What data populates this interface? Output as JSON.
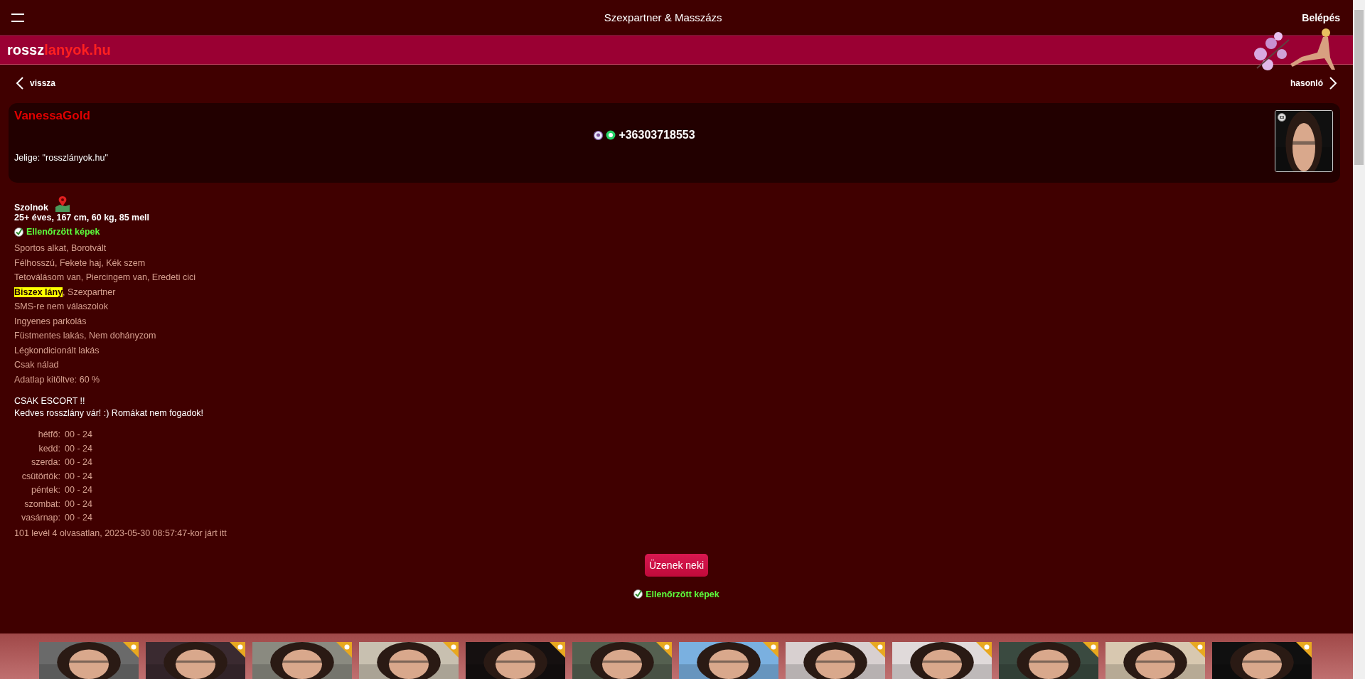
{
  "header": {
    "title": "Szexpartner & Masszázs",
    "login": "Belépés"
  },
  "logo": {
    "part_1": "rossz",
    "part_2": "lanyok.hu"
  },
  "nav": {
    "back": "vissza",
    "similar": "hasonló"
  },
  "profile": {
    "name": "VanessaGold",
    "phone": "+36303718553",
    "code": "Jelige: \"rosszlányok.hu\""
  },
  "details": {
    "city": "Szolnok",
    "stats": "25+ éves, 167 cm, 60 kg, 85 mell",
    "verified": "Ellenőrzött képek",
    "features": [
      {
        "parts": [
          {
            "text": "Sportos alkat, Borotvált",
            "highlighted": false
          }
        ]
      },
      {
        "parts": [
          {
            "text": "Félhosszú, Fekete haj, Kék szem",
            "highlighted": false
          }
        ]
      },
      {
        "parts": [
          {
            "text": "Tetoválásom van, Piercingem van, Eredeti cici",
            "highlighted": false
          }
        ]
      },
      {
        "parts": [
          {
            "text": "Biszex lány",
            "highlighted": true
          },
          {
            "text": ", Szexpartner",
            "highlighted": false
          }
        ]
      },
      {
        "parts": [
          {
            "text": "SMS-re nem válaszolok",
            "highlighted": false
          }
        ]
      },
      {
        "parts": [
          {
            "text": "Ingyenes parkolás",
            "highlighted": false
          }
        ]
      },
      {
        "parts": [
          {
            "text": "Füstmentes lakás, Nem dohányzom",
            "highlighted": false
          }
        ]
      },
      {
        "parts": [
          {
            "text": "Légkondicionált lakás",
            "highlighted": false
          }
        ]
      },
      {
        "parts": [
          {
            "text": "Csak nálad",
            "highlighted": false
          }
        ]
      },
      {
        "parts": [
          {
            "text": "Adatlap kitöltve: 60 %",
            "highlighted": false
          }
        ]
      }
    ],
    "notes": [
      "CSAK ESCORT !!",
      "Kedves rosszlány vár! :) Romákat nem fogadok!"
    ],
    "hours": [
      {
        "day": "hétfő:",
        "time": "00 - 24"
      },
      {
        "day": "kedd:",
        "time": "00 - 24"
      },
      {
        "day": "szerda:",
        "time": "00 - 24"
      },
      {
        "day": "csütörtök:",
        "time": "00 - 24"
      },
      {
        "day": "péntek:",
        "time": "00 - 24"
      },
      {
        "day": "szombat:",
        "time": "00 - 24"
      },
      {
        "day": "vasárnap:",
        "time": "00 - 24"
      }
    ],
    "last_seen": "101 levél 4 olvasatlan, 2023-05-30 08:57:47-kor járt itt"
  },
  "message_button": "Üzenek neki",
  "verified_bottom": "Ellenőrzött képek"
}
